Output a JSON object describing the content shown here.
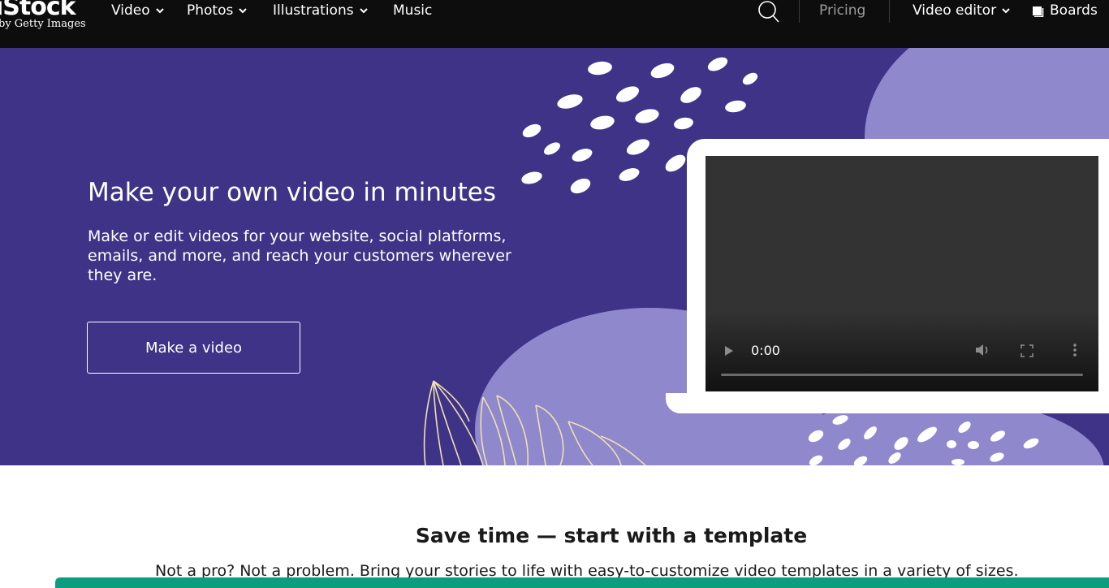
{
  "nav": {
    "logo_main": "iStock",
    "logo_sub": "by Getty Images",
    "items": [
      {
        "label": "Video",
        "has_dropdown": true
      },
      {
        "label": "Photos",
        "has_dropdown": true
      },
      {
        "label": "Illustrations",
        "has_dropdown": true
      },
      {
        "label": "Music",
        "has_dropdown": false
      }
    ],
    "search_icon": "search-icon",
    "pricing": "Pricing",
    "video_editor": "Video editor",
    "boards": "Boards"
  },
  "hero": {
    "title": "Make your own video in minutes",
    "description": "Make or edit videos for your website, social platforms, emails, and more, and reach your customers wherever they are.",
    "cta": "Make a video",
    "video": {
      "time": "0:00",
      "progress": 0
    },
    "colors": {
      "background": "#3f3388",
      "accent_light": "#8f88cc",
      "line_art": "#f0e0b0"
    }
  },
  "templates": {
    "title": "Save time — start with a template",
    "description": "Not a pro? Not a problem. Bring your stories to life with easy-to-customize video templates in a variety of sizes."
  },
  "colors": {
    "nav_background": "#0c0d0c",
    "banner_green": "#0c9d7f"
  }
}
